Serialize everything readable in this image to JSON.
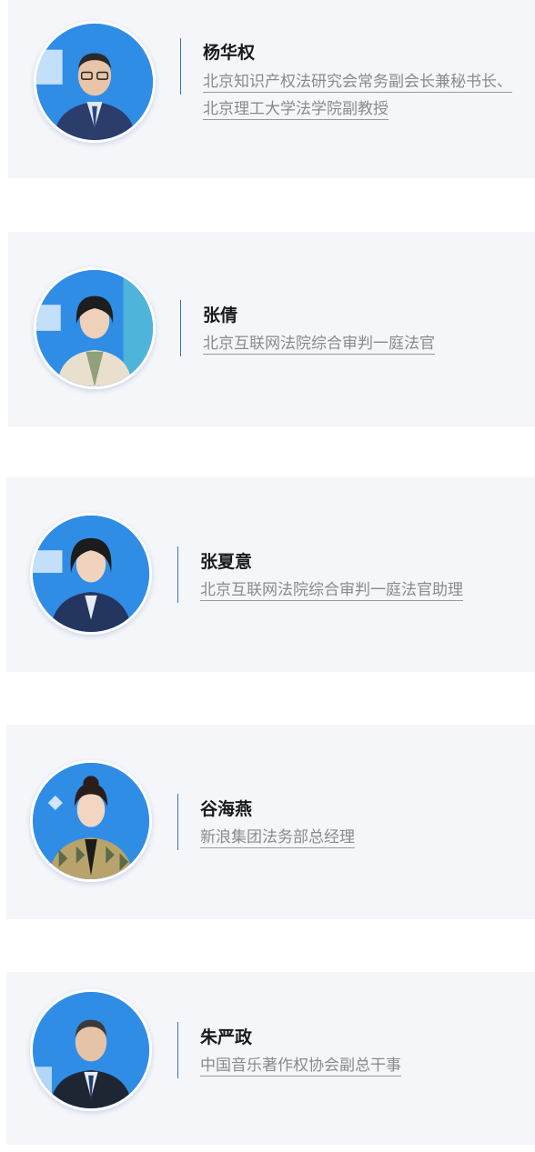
{
  "speakers": [
    {
      "name": "杨华权",
      "title": "北京知识产权法研究会常务副会长兼秘书长、北京理工大学法学院副教授",
      "photo_icon": "portrait-male-glasses"
    },
    {
      "name": "张倩",
      "title": "北京互联网法院综合审判一庭法官",
      "photo_icon": "portrait-female-beige-blazer"
    },
    {
      "name": "张夏意",
      "title": "北京互联网法院综合审判一庭法官助理",
      "photo_icon": "portrait-female-navy-suit"
    },
    {
      "name": "谷海燕",
      "title": "新浪集团法务部总经理",
      "photo_icon": "portrait-female-patterned-jacket"
    },
    {
      "name": "朱严政",
      "title": "中国音乐著作权协会副总干事",
      "photo_icon": "portrait-male-dark-suit"
    }
  ],
  "colors": {
    "card_background": "#f4f6fa",
    "divider": "#3a6fc4",
    "name_text": "#1a1a1a",
    "title_text": "#8a8a8a",
    "photo_backdrop": "#2f8de6"
  }
}
